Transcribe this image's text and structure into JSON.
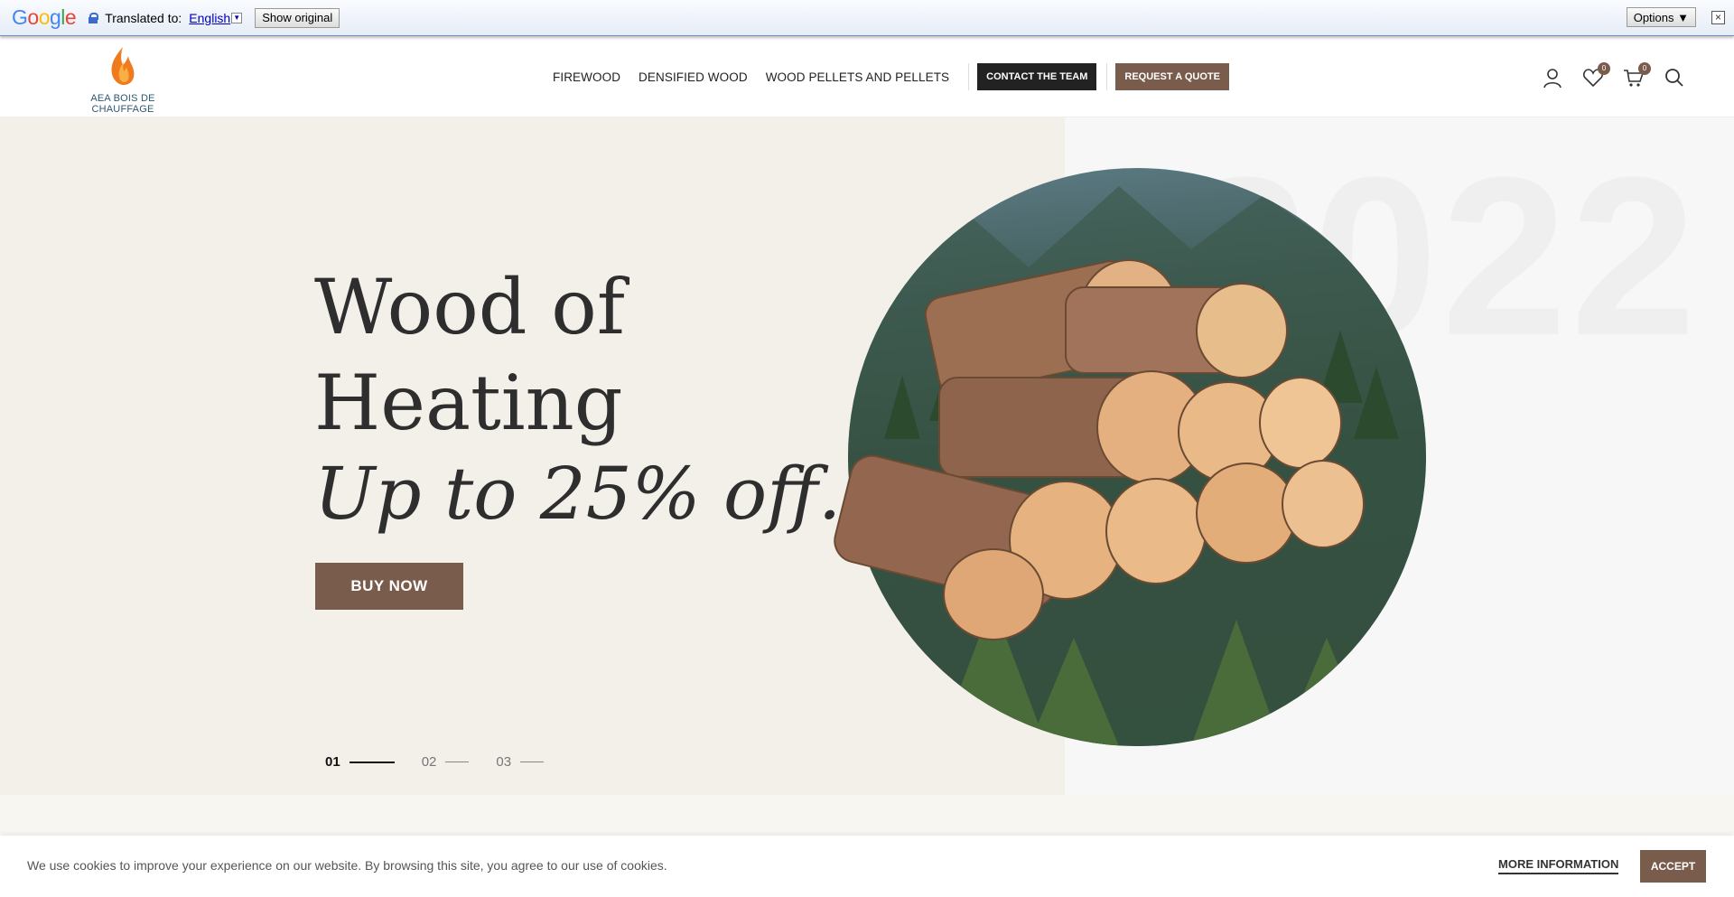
{
  "translate_bar": {
    "logo": "Google",
    "translated_to_label": "Translated to:",
    "language": "English",
    "show_original": "Show original",
    "options": "Options ▼",
    "close": "×"
  },
  "header": {
    "logo_text": "AEA BOIS DE CHAUFFAGE",
    "nav": {
      "firewood": "FIREWOOD",
      "densified": "DENSIFIED WOOD",
      "pellets": "WOOD PELLETS AND PELLETS",
      "contact": "CONTACT THE TEAM",
      "quote": "REQUEST A QUOTE"
    },
    "wishlist_count": "0",
    "cart_count": "0"
  },
  "hero": {
    "background_year": "2022",
    "title_line1": "Wood of",
    "title_line2": "Heating",
    "title_line3": "Up to 25% off.",
    "cta": "BUY NOW",
    "slides": [
      {
        "num": "01"
      },
      {
        "num": "02"
      },
      {
        "num": "03"
      }
    ]
  },
  "cookie": {
    "text": "We use cookies to improve your experience on our website. By browsing this site, you agree to our use of cookies.",
    "more": "MORE INFORMATION",
    "accept": "ACCEPT"
  },
  "colors": {
    "brand_brown": "#7a5c4d",
    "dark": "#222222",
    "hero_bg": "#f3efe9"
  }
}
